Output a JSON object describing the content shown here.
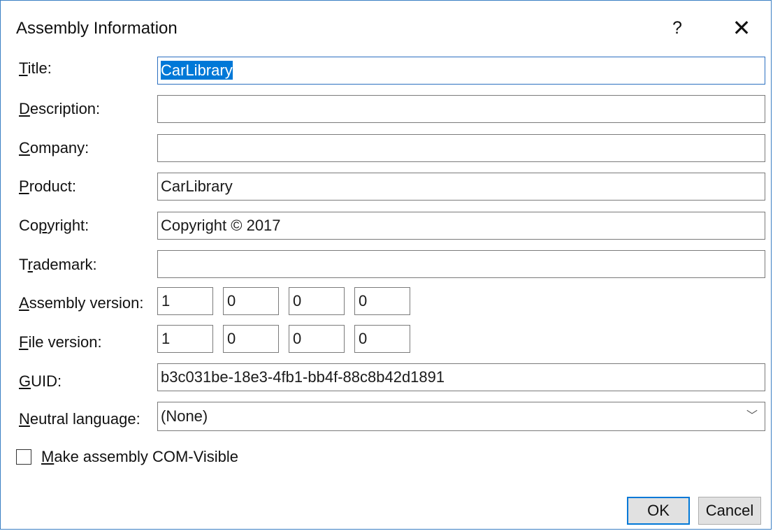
{
  "window": {
    "title": "Assembly Information",
    "help_glyph": "?",
    "close_glyph": "✕"
  },
  "fields": {
    "title": {
      "label_mn": "T",
      "label_rest": "itle:",
      "value": "CarLibrary"
    },
    "description": {
      "label_mn": "D",
      "label_rest": "escription:",
      "value": ""
    },
    "company": {
      "label_mn": "C",
      "label_rest": "ompany:",
      "value": ""
    },
    "product": {
      "label_mn": "P",
      "label_rest": "roduct:",
      "value": "CarLibrary"
    },
    "copyright": {
      "label_pre": "Co",
      "label_mn": "p",
      "label_rest": "yright:",
      "value": "Copyright ©  2017"
    },
    "trademark": {
      "label_pre": "T",
      "label_mn": "r",
      "label_rest": "ademark:",
      "value": ""
    },
    "assembly_version": {
      "label_mn": "A",
      "label_rest": "ssembly version:",
      "values": [
        "1",
        "0",
        "0",
        "0"
      ]
    },
    "file_version": {
      "label_mn": "F",
      "label_rest": "ile version:",
      "values": [
        "1",
        "0",
        "0",
        "0"
      ]
    },
    "guid": {
      "label_mn": "G",
      "label_rest": "UID:",
      "value": "b3c031be-18e3-4fb1-bb4f-88c8b42d1891"
    },
    "neutral_language": {
      "label_mn": "N",
      "label_rest": "eutral language:",
      "value": "(None)",
      "chevron": "﹀"
    }
  },
  "com_visible": {
    "label_mn": "M",
    "label_rest": "ake assembly COM-Visible",
    "checked": false
  },
  "buttons": {
    "ok": "OK",
    "cancel": "Cancel"
  },
  "colors": {
    "accent": "#0078d7",
    "border": "#3a7fc4",
    "button_face": "#e1e1e1"
  }
}
